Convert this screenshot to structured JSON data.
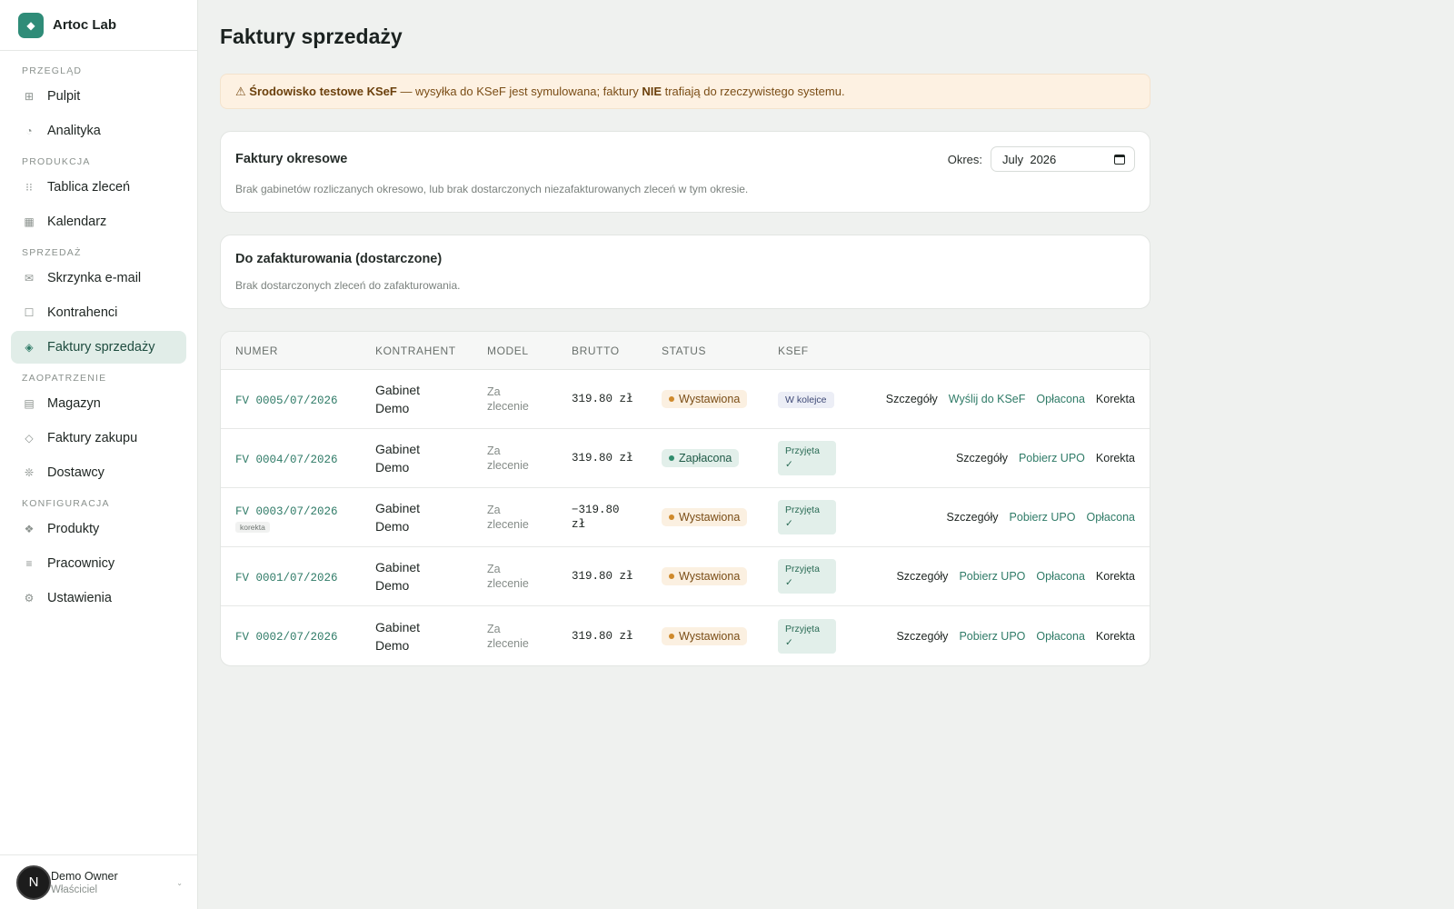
{
  "brand": {
    "logo_glyph": "◆",
    "name": "Artoc Lab"
  },
  "sidebar": {
    "sections": [
      {
        "label": "PRZEGLĄD",
        "items": [
          {
            "label": "Pulpit",
            "icon": "⊞",
            "icon_name": "grid-icon"
          },
          {
            "label": "Analityka",
            "icon": "◔",
            "icon_name": "pie-chart-icon"
          }
        ]
      },
      {
        "label": "PRODUKCJA",
        "items": [
          {
            "label": "Tablica zleceń",
            "icon": "⁝⁝",
            "icon_name": "kanban-icon"
          },
          {
            "label": "Kalendarz",
            "icon": "▦",
            "icon_name": "calendar-icon"
          }
        ]
      },
      {
        "label": "SPRZEDAŻ",
        "items": [
          {
            "label": "Skrzynka e-mail",
            "icon": "✉",
            "icon_name": "mail-icon"
          },
          {
            "label": "Kontrahenci",
            "icon": "☐",
            "icon_name": "contacts-icon"
          },
          {
            "label": "Faktury sprzedaży",
            "icon": "◈",
            "icon_name": "invoice-icon",
            "active": true
          }
        ]
      },
      {
        "label": "ZAOPATRZENIE",
        "items": [
          {
            "label": "Magazyn",
            "icon": "▤",
            "icon_name": "warehouse-icon"
          },
          {
            "label": "Faktury zakupu",
            "icon": "◇",
            "icon_name": "purchase-invoice-icon"
          },
          {
            "label": "Dostawcy",
            "icon": "❊",
            "icon_name": "suppliers-icon"
          }
        ]
      },
      {
        "label": "KONFIGURACJA",
        "items": [
          {
            "label": "Produkty",
            "icon": "❖",
            "icon_name": "products-icon"
          },
          {
            "label": "Pracownicy",
            "icon": "≡",
            "icon_name": "employees-icon"
          },
          {
            "label": "Ustawienia",
            "icon": "⚙",
            "icon_name": "settings-icon"
          }
        ]
      }
    ]
  },
  "user": {
    "avatar": "N",
    "name": "Demo Owner",
    "role": "Właściciel",
    "menu_glyph": "⌄"
  },
  "page": {
    "title": "Faktury sprzedaży"
  },
  "banner": {
    "icon": "⚠",
    "bold1": "Środowisko testowe KSeF",
    "text1": " — wysyłka do KSeF jest symulowana; faktury ",
    "bold2": "NIE",
    "text2": " trafiają do rzeczywistego systemu."
  },
  "periodic": {
    "title": "Faktury okresowe",
    "period_label": "Okres:",
    "period_value": "July  2026",
    "desc": "Brak gabinetów rozliczanych okresowo, lub brak dostarczonych niezafakturowanych zleceń w tym okresie."
  },
  "todo": {
    "title": "Do zafakturowania (dostarczone)",
    "desc": "Brak dostarczonych zleceń do zafakturowania."
  },
  "table": {
    "headers": [
      "NUMER",
      "KONTRAHENT",
      "MODEL",
      "BRUTTO",
      "STATUS",
      "KSEF"
    ],
    "rows": [
      {
        "number": "FV 0005/07/2026",
        "tag": "",
        "kontrahent": [
          "Gabinet",
          "Demo"
        ],
        "model": [
          "Za",
          "zlecenie"
        ],
        "brutto": [
          "319.80 zł"
        ],
        "status": "Wystawiona",
        "status_kind": "issued",
        "ksef": [
          "W kolejce"
        ],
        "ksef_kind": "queue",
        "actions": [
          {
            "label": "Szczegóły",
            "tone": "dark"
          },
          {
            "label": "Wyślij do KSeF",
            "tone": "green"
          },
          {
            "label": "Opłacona",
            "tone": "green"
          },
          {
            "label": "Korekta",
            "tone": "dark"
          }
        ]
      },
      {
        "number": "FV 0004/07/2026",
        "tag": "",
        "kontrahent": [
          "Gabinet",
          "Demo"
        ],
        "model": [
          "Za",
          "zlecenie"
        ],
        "brutto": [
          "319.80 zł"
        ],
        "status": "Zapłacona",
        "status_kind": "paid",
        "ksef": [
          "Przyjęta",
          "✓"
        ],
        "ksef_kind": "ok",
        "actions": [
          {
            "label": "Szczegóły",
            "tone": "dark"
          },
          {
            "label": "Pobierz UPO",
            "tone": "green"
          },
          {
            "label": "Korekta",
            "tone": "dark"
          }
        ]
      },
      {
        "number": "FV 0003/07/2026",
        "tag": "korekta",
        "kontrahent": [
          "Gabinet",
          "Demo"
        ],
        "model": [
          "Za",
          "zlecenie"
        ],
        "brutto": [
          "−319.80",
          "zł"
        ],
        "status": "Wystawiona",
        "status_kind": "issued",
        "ksef": [
          "Przyjęta",
          "✓"
        ],
        "ksef_kind": "ok",
        "actions": [
          {
            "label": "Szczegóły",
            "tone": "dark"
          },
          {
            "label": "Pobierz UPO",
            "tone": "green"
          },
          {
            "label": "Opłacona",
            "tone": "green"
          }
        ]
      },
      {
        "number": "FV 0001/07/2026",
        "tag": "",
        "kontrahent": [
          "Gabinet",
          "Demo"
        ],
        "model": [
          "Za",
          "zlecenie"
        ],
        "brutto": [
          "319.80 zł"
        ],
        "status": "Wystawiona",
        "status_kind": "issued",
        "ksef": [
          "Przyjęta",
          "✓"
        ],
        "ksef_kind": "ok",
        "actions": [
          {
            "label": "Szczegóły",
            "tone": "dark"
          },
          {
            "label": "Pobierz UPO",
            "tone": "green"
          },
          {
            "label": "Opłacona",
            "tone": "green"
          },
          {
            "label": "Korekta",
            "tone": "dark"
          }
        ]
      },
      {
        "number": "FV 0002/07/2026",
        "tag": "",
        "kontrahent": [
          "Gabinet",
          "Demo"
        ],
        "model": [
          "Za",
          "zlecenie"
        ],
        "brutto": [
          "319.80 zł"
        ],
        "status": "Wystawiona",
        "status_kind": "issued",
        "ksef": [
          "Przyjęta",
          "✓"
        ],
        "ksef_kind": "ok",
        "actions": [
          {
            "label": "Szczegóły",
            "tone": "dark"
          },
          {
            "label": "Pobierz UPO",
            "tone": "green"
          },
          {
            "label": "Opłacona",
            "tone": "green"
          },
          {
            "label": "Korekta",
            "tone": "dark"
          }
        ]
      }
    ]
  },
  "colors": {
    "accent": "#2f8c78",
    "link": "#2f7b67",
    "warning_bg": "#fdf1e2",
    "issued_dot": "#cf8a2c",
    "paid_dot": "#2f8c6c"
  }
}
